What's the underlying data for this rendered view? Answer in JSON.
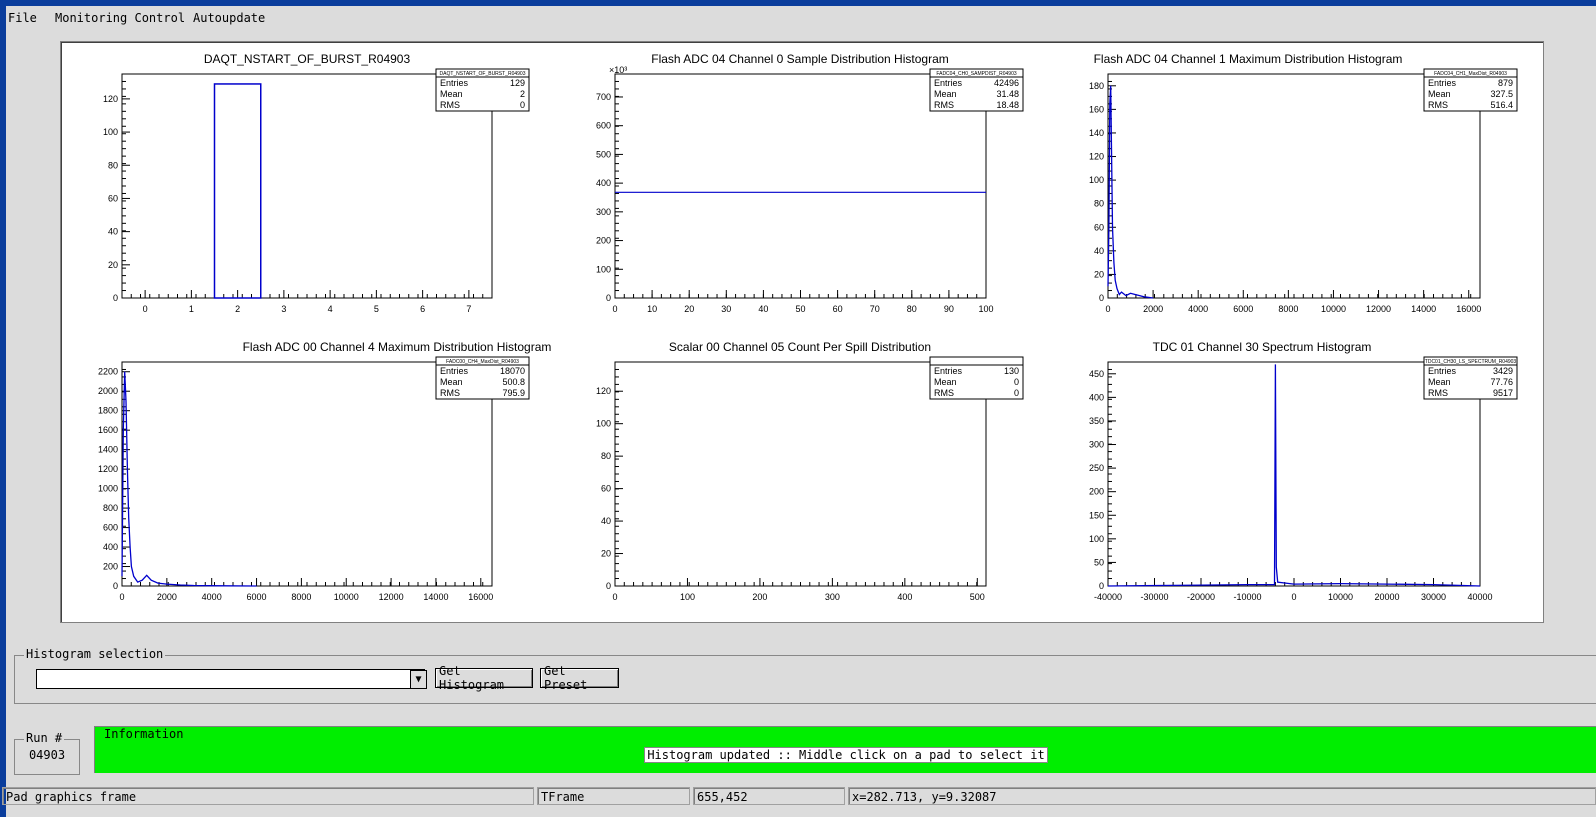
{
  "menu": [
    "File",
    "Monitoring Control",
    "Autoupdate"
  ],
  "selection": {
    "group_label": "Histogram selection",
    "combo_value": "",
    "get_histogram": "Get Histogram",
    "get_preset": "Get Preset"
  },
  "run": {
    "label": "Run #",
    "value": "04903"
  },
  "info": {
    "label": "Information",
    "message": "Histogram updated :: Middle click on a pad to select it"
  },
  "statusbar": [
    "Pad graphics frame",
    "TFrame",
    "655,452",
    "x=282.713, y=9.32087"
  ],
  "colors": {
    "background": "#0a3d9c",
    "window": "#dcdcdc",
    "info_green": "#00ee00",
    "histogram_line": "#0000cc"
  },
  "chart_data": [
    {
      "type": "histogram",
      "title": "DAQT_NSTART_OF_BURST_R04903",
      "stats_name": "DAQT_NSTART_OF_BURST_R04903",
      "stats": {
        "Entries": "129",
        "Mean": "2",
        "RMS": "0"
      },
      "x_ticks": [
        "0",
        "1",
        "2",
        "3",
        "4",
        "5",
        "6",
        "7"
      ],
      "y_ticks": [
        "0",
        "20",
        "40",
        "60",
        "80",
        "100",
        "120"
      ],
      "xlim": [
        -0.5,
        7.5
      ],
      "ylim": [
        0,
        135
      ],
      "bins": [
        {
          "x0": 1.5,
          "x1": 2.5,
          "y": 129
        }
      ]
    },
    {
      "type": "histogram",
      "title": "Flash ADC 04 Channel 0 Sample Distribution Histogram",
      "stats_name": "FADC04_CH0_SAMPDIST_R04903",
      "stats": {
        "Entries": "42496",
        "Mean": "31.48",
        "RMS": "18.48"
      },
      "multiplier": "×10³",
      "x_ticks": [
        "0",
        "10",
        "20",
        "30",
        "40",
        "50",
        "60",
        "70",
        "80",
        "90",
        "100"
      ],
      "y_ticks": [
        "0",
        "100",
        "200",
        "300",
        "400",
        "500",
        "600",
        "700"
      ],
      "xlim": [
        0,
        100
      ],
      "ylim": [
        0,
        780
      ],
      "line_y": 368
    },
    {
      "type": "histogram",
      "title": "Flash ADC 04 Channel 1 Maximum Distribution Histogram",
      "stats_name": "FADC04_CH1_MaxDist_R04903",
      "stats": {
        "Entries": "879",
        "Mean": "327.5",
        "RMS": "516.4"
      },
      "x_ticks": [
        "0",
        "2000",
        "4000",
        "6000",
        "8000",
        "10000",
        "12000",
        "14000",
        "16000"
      ],
      "y_ticks": [
        "0",
        "20",
        "40",
        "60",
        "80",
        "100",
        "120",
        "140",
        "160",
        "180"
      ],
      "xlim": [
        0,
        16500
      ],
      "ylim": [
        0,
        190
      ],
      "points": [
        [
          0,
          10
        ],
        [
          40,
          60
        ],
        [
          80,
          165
        ],
        [
          120,
          180
        ],
        [
          160,
          120
        ],
        [
          200,
          60
        ],
        [
          260,
          30
        ],
        [
          320,
          15
        ],
        [
          400,
          8
        ],
        [
          500,
          3
        ],
        [
          600,
          5
        ],
        [
          800,
          2
        ],
        [
          1000,
          4
        ],
        [
          1200,
          3
        ],
        [
          1400,
          2
        ],
        [
          1600,
          1
        ],
        [
          2000,
          0
        ]
      ]
    },
    {
      "type": "histogram",
      "title": "Flash ADC 00 Channel 4 Maximum Distribution Histogram",
      "stats_name": "FADC00_CH4_MaxDist_R04903",
      "stats": {
        "Entries": "18070",
        "Mean": "500.8",
        "RMS": "795.9"
      },
      "x_ticks": [
        "0",
        "2000",
        "4000",
        "6000",
        "8000",
        "10000",
        "12000",
        "14000",
        "16000"
      ],
      "y_ticks": [
        "0",
        "200",
        "400",
        "600",
        "800",
        "1000",
        "1200",
        "1400",
        "1600",
        "1800",
        "2000",
        "2200"
      ],
      "xlim": [
        0,
        16500
      ],
      "ylim": [
        0,
        2300
      ],
      "points": [
        [
          0,
          100
        ],
        [
          60,
          1600
        ],
        [
          120,
          2200
        ],
        [
          180,
          1900
        ],
        [
          240,
          1200
        ],
        [
          300,
          700
        ],
        [
          360,
          400
        ],
        [
          420,
          200
        ],
        [
          520,
          100
        ],
        [
          700,
          40
        ],
        [
          900,
          60
        ],
        [
          1100,
          110
        ],
        [
          1300,
          60
        ],
        [
          1600,
          30
        ],
        [
          2000,
          20
        ],
        [
          2600,
          10
        ],
        [
          3200,
          5
        ],
        [
          4500,
          2
        ],
        [
          6000,
          0
        ]
      ]
    },
    {
      "type": "histogram",
      "title": "Scalar 00 Channel 05 Count Per Spill Distribution",
      "stats_name": "",
      "stats": {
        "Entries": "130",
        "Mean": "0",
        "RMS": "0"
      },
      "x_ticks": [
        "0",
        "100",
        "200",
        "300",
        "400",
        "500"
      ],
      "y_ticks": [
        "0",
        "20",
        "40",
        "60",
        "80",
        "100",
        "120"
      ],
      "xlim": [
        0,
        512
      ],
      "ylim": [
        0,
        138
      ]
    },
    {
      "type": "histogram",
      "title": "TDC 01 Channel 30 Spectrum Histogram",
      "stats_name": "TDC01_CH30_LS_SPECTRUM_R04903",
      "stats": {
        "Entries": "3429",
        "Mean": "77.76",
        "RMS": "9517"
      },
      "x_ticks": [
        "-40000",
        "-30000",
        "-20000",
        "-10000",
        "0",
        "10000",
        "20000",
        "30000",
        "40000"
      ],
      "y_ticks": [
        "0",
        "50",
        "100",
        "150",
        "200",
        "250",
        "300",
        "350",
        "400",
        "450"
      ],
      "xlim": [
        -40000,
        40000
      ],
      "ylim": [
        0,
        475
      ],
      "points": [
        [
          -40000,
          0
        ],
        [
          -20000,
          2
        ],
        [
          -10000,
          3
        ],
        [
          -4200,
          3
        ],
        [
          -4000,
          470
        ],
        [
          -3800,
          40
        ],
        [
          -3500,
          8
        ],
        [
          0,
          4
        ],
        [
          10000,
          5
        ],
        [
          20000,
          4
        ],
        [
          30000,
          3
        ],
        [
          40000,
          0
        ]
      ]
    }
  ]
}
